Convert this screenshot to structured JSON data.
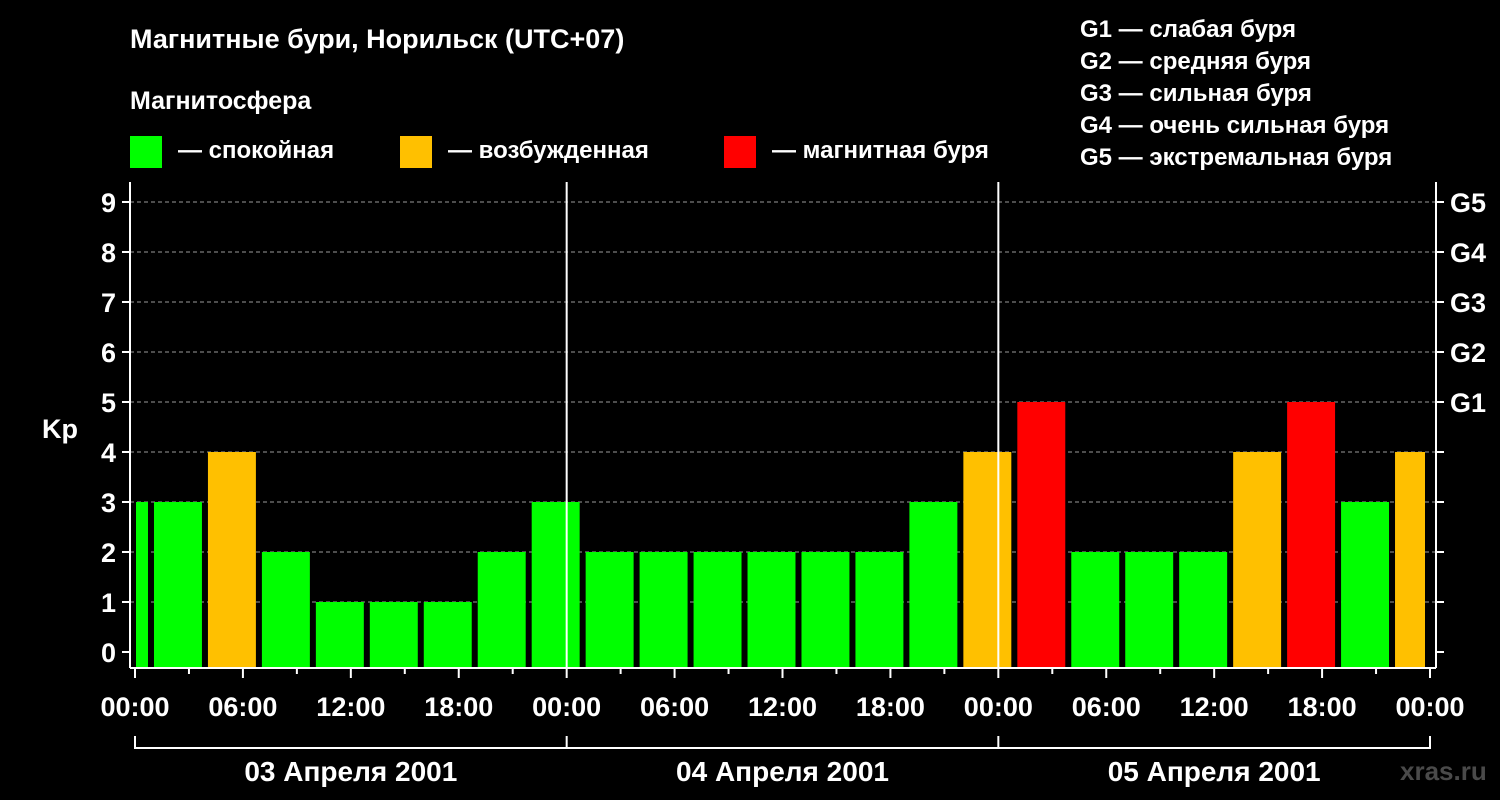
{
  "title": "Магнитные бури, Норильск (UTC+07)",
  "legend": {
    "heading": "Магнитосфера",
    "items": [
      {
        "label": "— спокойная",
        "color": "#00ff00"
      },
      {
        "label": "— возбужденная",
        "color": "#ffc000"
      },
      {
        "label": "— магнитная буря",
        "color": "#ff0000"
      }
    ]
  },
  "storm_levels": [
    "G1 — слабая буря",
    "G2 — средняя буря",
    "G3 — сильная буря",
    "G4 — очень сильная буря",
    "G5 — экстремальная буря"
  ],
  "watermark": "xras.ru",
  "chart_data": {
    "type": "bar",
    "title": "Магнитные бури, Норильск (UTC+07)",
    "ylabel": "Kp",
    "xlabel": "",
    "ylim": [
      0,
      9
    ],
    "yticks": [
      0,
      1,
      2,
      3,
      4,
      5,
      6,
      7,
      8,
      9
    ],
    "right_axis": [
      {
        "value": 5,
        "label": "G1"
      },
      {
        "value": 6,
        "label": "G2"
      },
      {
        "value": 7,
        "label": "G3"
      },
      {
        "value": 8,
        "label": "G4"
      },
      {
        "value": 9,
        "label": "G5"
      }
    ],
    "x_range_hours": [
      0,
      72
    ],
    "x_ticks": [
      {
        "hour": 0,
        "label": "00:00"
      },
      {
        "hour": 6,
        "label": "06:00"
      },
      {
        "hour": 12,
        "label": "12:00"
      },
      {
        "hour": 18,
        "label": "18:00"
      },
      {
        "hour": 24,
        "label": "00:00"
      },
      {
        "hour": 30,
        "label": "06:00"
      },
      {
        "hour": 36,
        "label": "12:00"
      },
      {
        "hour": 42,
        "label": "18:00"
      },
      {
        "hour": 48,
        "label": "00:00"
      },
      {
        "hour": 54,
        "label": "06:00"
      },
      {
        "hour": 60,
        "label": "12:00"
      },
      {
        "hour": 66,
        "label": "18:00"
      },
      {
        "hour": 72,
        "label": "00:00"
      }
    ],
    "day_separators_hours": [
      24,
      48
    ],
    "days": [
      {
        "label": "03 Апреля 2001",
        "start": 0,
        "end": 24
      },
      {
        "label": "04 Апреля 2001",
        "start": 24,
        "end": 48
      },
      {
        "label": "05 Апреля 2001",
        "start": 48,
        "end": 72
      }
    ],
    "bars": [
      {
        "start": 0,
        "end": 1,
        "kp": 3,
        "state": "calm"
      },
      {
        "start": 1,
        "end": 4,
        "kp": 3,
        "state": "calm"
      },
      {
        "start": 4,
        "end": 7,
        "kp": 4,
        "state": "excited"
      },
      {
        "start": 7,
        "end": 10,
        "kp": 2,
        "state": "calm"
      },
      {
        "start": 10,
        "end": 13,
        "kp": 1,
        "state": "calm"
      },
      {
        "start": 13,
        "end": 16,
        "kp": 1,
        "state": "calm"
      },
      {
        "start": 16,
        "end": 19,
        "kp": 1,
        "state": "calm"
      },
      {
        "start": 19,
        "end": 22,
        "kp": 2,
        "state": "calm"
      },
      {
        "start": 22,
        "end": 25,
        "kp": 3,
        "state": "calm"
      },
      {
        "start": 25,
        "end": 28,
        "kp": 2,
        "state": "calm"
      },
      {
        "start": 28,
        "end": 31,
        "kp": 2,
        "state": "calm"
      },
      {
        "start": 31,
        "end": 34,
        "kp": 2,
        "state": "calm"
      },
      {
        "start": 34,
        "end": 37,
        "kp": 2,
        "state": "calm"
      },
      {
        "start": 37,
        "end": 40,
        "kp": 2,
        "state": "calm"
      },
      {
        "start": 40,
        "end": 43,
        "kp": 2,
        "state": "calm"
      },
      {
        "start": 43,
        "end": 46,
        "kp": 3,
        "state": "calm"
      },
      {
        "start": 46,
        "end": 49,
        "kp": 4,
        "state": "excited"
      },
      {
        "start": 49,
        "end": 52,
        "kp": 5,
        "state": "storm"
      },
      {
        "start": 52,
        "end": 55,
        "kp": 2,
        "state": "calm"
      },
      {
        "start": 55,
        "end": 58,
        "kp": 2,
        "state": "calm"
      },
      {
        "start": 58,
        "end": 61,
        "kp": 2,
        "state": "calm"
      },
      {
        "start": 61,
        "end": 64,
        "kp": 4,
        "state": "excited"
      },
      {
        "start": 64,
        "end": 67,
        "kp": 5,
        "state": "storm"
      },
      {
        "start": 67,
        "end": 70,
        "kp": 3,
        "state": "calm"
      },
      {
        "start": 70,
        "end": 72,
        "kp": 4,
        "state": "excited"
      }
    ],
    "colors": {
      "calm": "#00ff00",
      "excited": "#ffc000",
      "storm": "#ff0000",
      "background": "#000000",
      "axis": "#ffffff",
      "grid": "#9a9a9a"
    },
    "grid": true,
    "legend_position": "top"
  }
}
